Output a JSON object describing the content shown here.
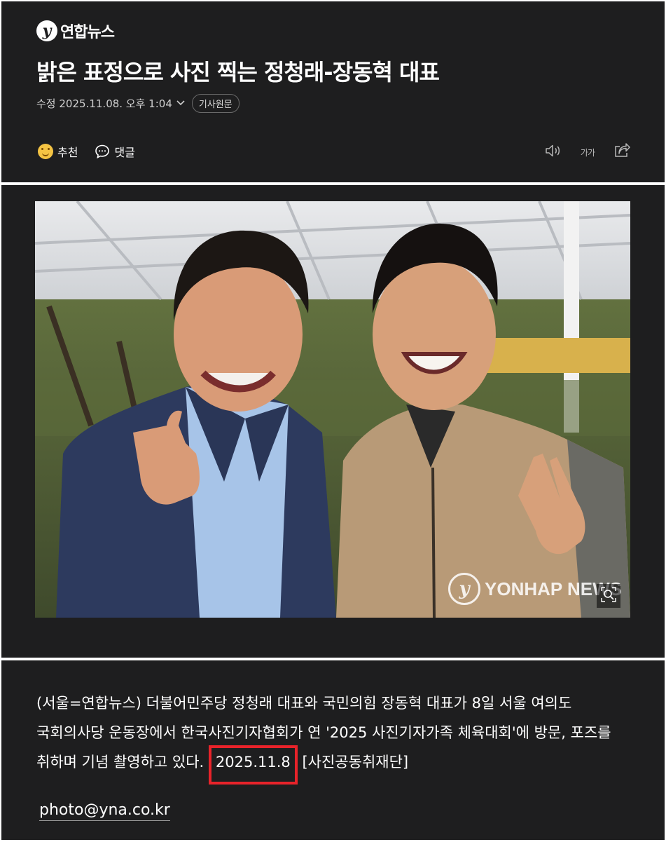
{
  "header": {
    "logo_text": "연합뉴스",
    "headline": "밝은 표정으로 사진 찍는 정청래-장동혁 대표",
    "modified_label": "수정",
    "modified_datetime": "2025.11.08. 오후 1:04",
    "original_article_label": "기사원문"
  },
  "actions": {
    "recommend_label": "추천",
    "comment_label": "댓글",
    "font_size_icon": "가가"
  },
  "icons": {
    "logo": "yonhap-logo-icon",
    "recommend": "smile-icon",
    "comment": "speech-bubble-icon",
    "tts": "speaker-icon",
    "font_size": "font-size-icon",
    "share": "share-icon",
    "zoom": "zoom-icon"
  },
  "photo": {
    "watermark": "YONHAP NEWS"
  },
  "article": {
    "caption_before": "(서울=연합뉴스) 더불어민주당 정청래 대표와 국민의힘 장동혁 대표가 8일 서울 여의도 국회의사당 운동장에서 한국사진기자협회가 연 '2025 사진기자가족 체육대회'에 방문, 포즈를 취하며 기념 촬영하고 있다. ",
    "caption_date": "2025.11.8",
    "caption_after": " [사진공동취재단]",
    "email": "photo@yna.co.kr"
  },
  "colors": {
    "background": "#1e1e1f",
    "highlight_box": "#e8232a"
  }
}
